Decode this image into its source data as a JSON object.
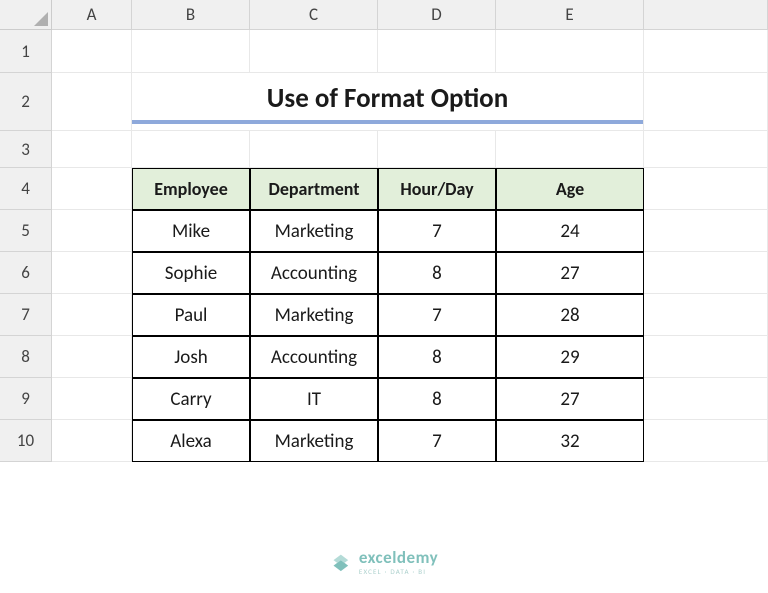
{
  "columns": [
    "A",
    "B",
    "C",
    "D",
    "E"
  ],
  "rows": [
    "1",
    "2",
    "3",
    "4",
    "5",
    "6",
    "7",
    "8",
    "9",
    "10"
  ],
  "title": "Use of Format Option",
  "table": {
    "headers": [
      "Employee",
      "Department",
      "Hour/Day",
      "Age"
    ],
    "data": [
      [
        "Mike",
        "Marketing",
        "7",
        "24"
      ],
      [
        "Sophie",
        "Accounting",
        "8",
        "27"
      ],
      [
        "Paul",
        "Marketing",
        "7",
        "28"
      ],
      [
        "Josh",
        "Accounting",
        "8",
        "29"
      ],
      [
        "Carry",
        "IT",
        "8",
        "27"
      ],
      [
        "Alexa",
        "Marketing",
        "7",
        "32"
      ]
    ]
  },
  "watermark": {
    "brand": "exceldemy",
    "subtitle": "EXCEL · DATA · BI"
  }
}
